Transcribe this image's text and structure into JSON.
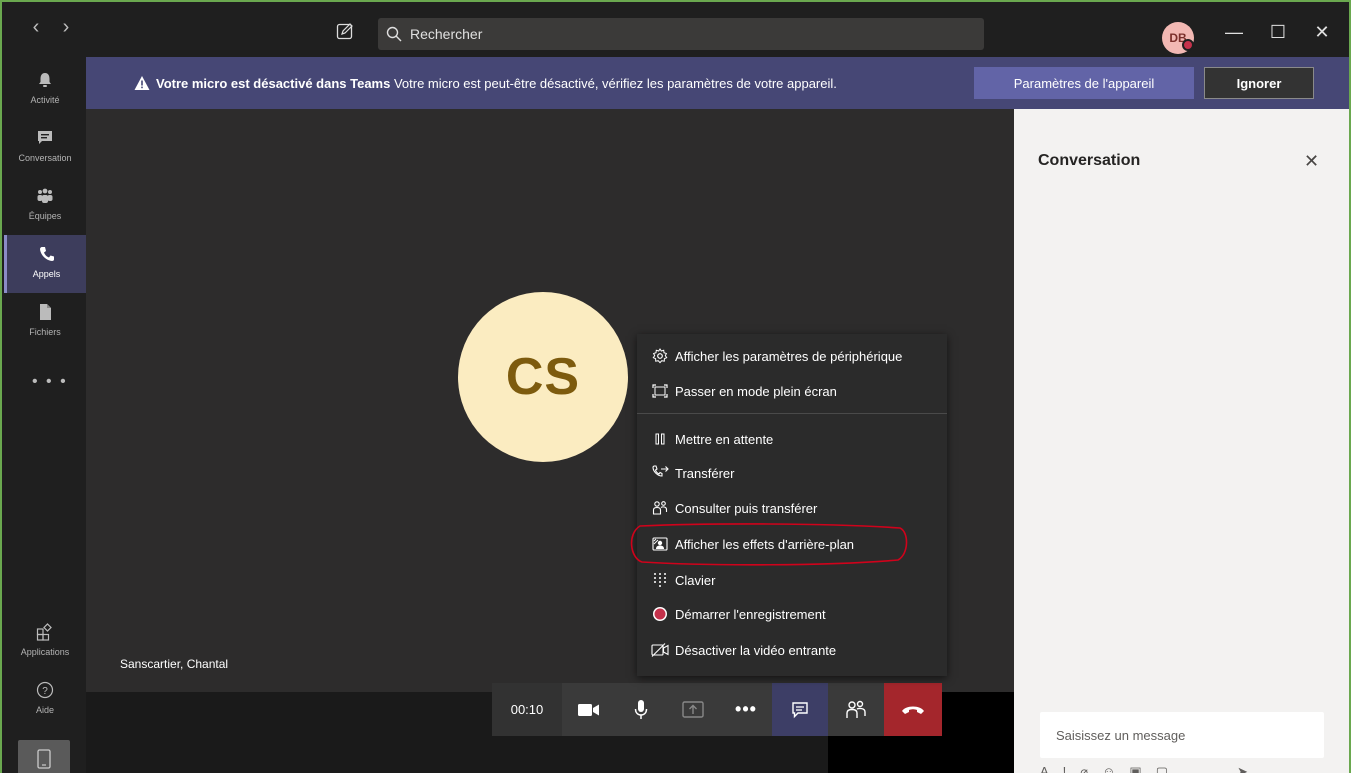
{
  "titlebar": {
    "search_placeholder": "Rechercher",
    "avatar_initials": "DB"
  },
  "rail": {
    "items": [
      {
        "label": "Activité",
        "icon": "bell-icon"
      },
      {
        "label": "Conversation",
        "icon": "chat-icon"
      },
      {
        "label": "Équipes",
        "icon": "teams-icon"
      },
      {
        "label": "Appels",
        "icon": "phone-icon"
      },
      {
        "label": "Fichiers",
        "icon": "file-icon"
      }
    ],
    "more": "• • •",
    "apps_label": "Applications",
    "help_label": "Aide"
  },
  "banner": {
    "bold_text": "Votre micro est désactivé dans Teams",
    "text": " Votre micro est peut-être désactivé, vérifiez les paramètres de votre appareil.",
    "device_button": "Paramètres de l'appareil",
    "ignore_button": "Ignorer"
  },
  "stage": {
    "avatar_initials": "CS",
    "participant_name": "Sanscartier, Chantal"
  },
  "controls": {
    "timer": "00:10"
  },
  "menu": {
    "items": [
      {
        "label": "Afficher les paramètres de périphérique",
        "icon": "gear-icon"
      },
      {
        "label": "Passer en mode plein écran",
        "icon": "fullscreen-icon"
      },
      {
        "label": "Mettre en attente",
        "icon": "pause-icon"
      },
      {
        "label": "Transférer",
        "icon": "transfer-icon"
      },
      {
        "label": "Consulter puis transférer",
        "icon": "consult-transfer-icon"
      },
      {
        "label": "Afficher les effets d'arrière-plan",
        "icon": "background-effects-icon"
      },
      {
        "label": "Clavier",
        "icon": "dialpad-icon"
      },
      {
        "label": "Démarrer l'enregistrement",
        "icon": "record-icon"
      },
      {
        "label": "Désactiver la vidéo entrante",
        "icon": "video-off-icon"
      }
    ]
  },
  "panel": {
    "title": "Conversation",
    "message_placeholder": "Saisissez un message"
  },
  "colors": {
    "accent": "#6264a7",
    "banner": "#464775",
    "hangup": "#a4262c",
    "record": "#c4314b"
  }
}
